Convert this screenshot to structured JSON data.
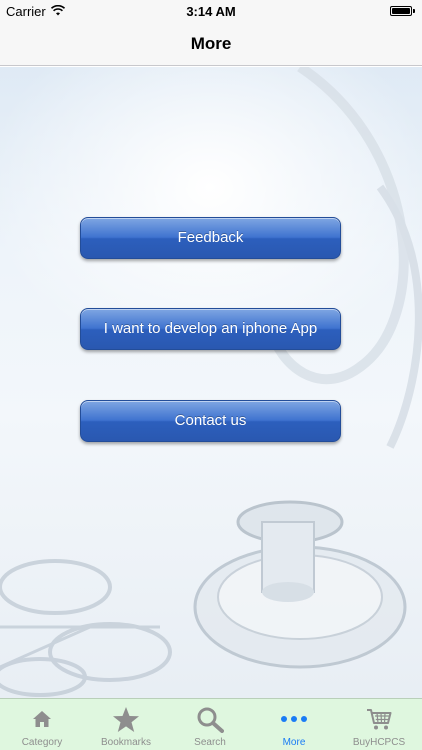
{
  "status_bar": {
    "carrier": "Carrier",
    "time": "3:14 AM"
  },
  "nav": {
    "title": "More"
  },
  "buttons": {
    "feedback": "Feedback",
    "develop": "I want to develop an iphone App",
    "contact": "Contact us"
  },
  "tabs": [
    {
      "label": "Category",
      "icon": "home-icon"
    },
    {
      "label": "Bookmarks",
      "icon": "star-icon"
    },
    {
      "label": "Search",
      "icon": "search-icon"
    },
    {
      "label": "More",
      "icon": "more-dots-icon",
      "active": true
    },
    {
      "label": "BuyHCPCS",
      "icon": "cart-icon"
    }
  ],
  "colors": {
    "accent": "#1a7cf5",
    "button_blue": "#3f73cf",
    "tab_bar_bg": "#dff7df",
    "inactive_tab": "#8e8e8e"
  }
}
